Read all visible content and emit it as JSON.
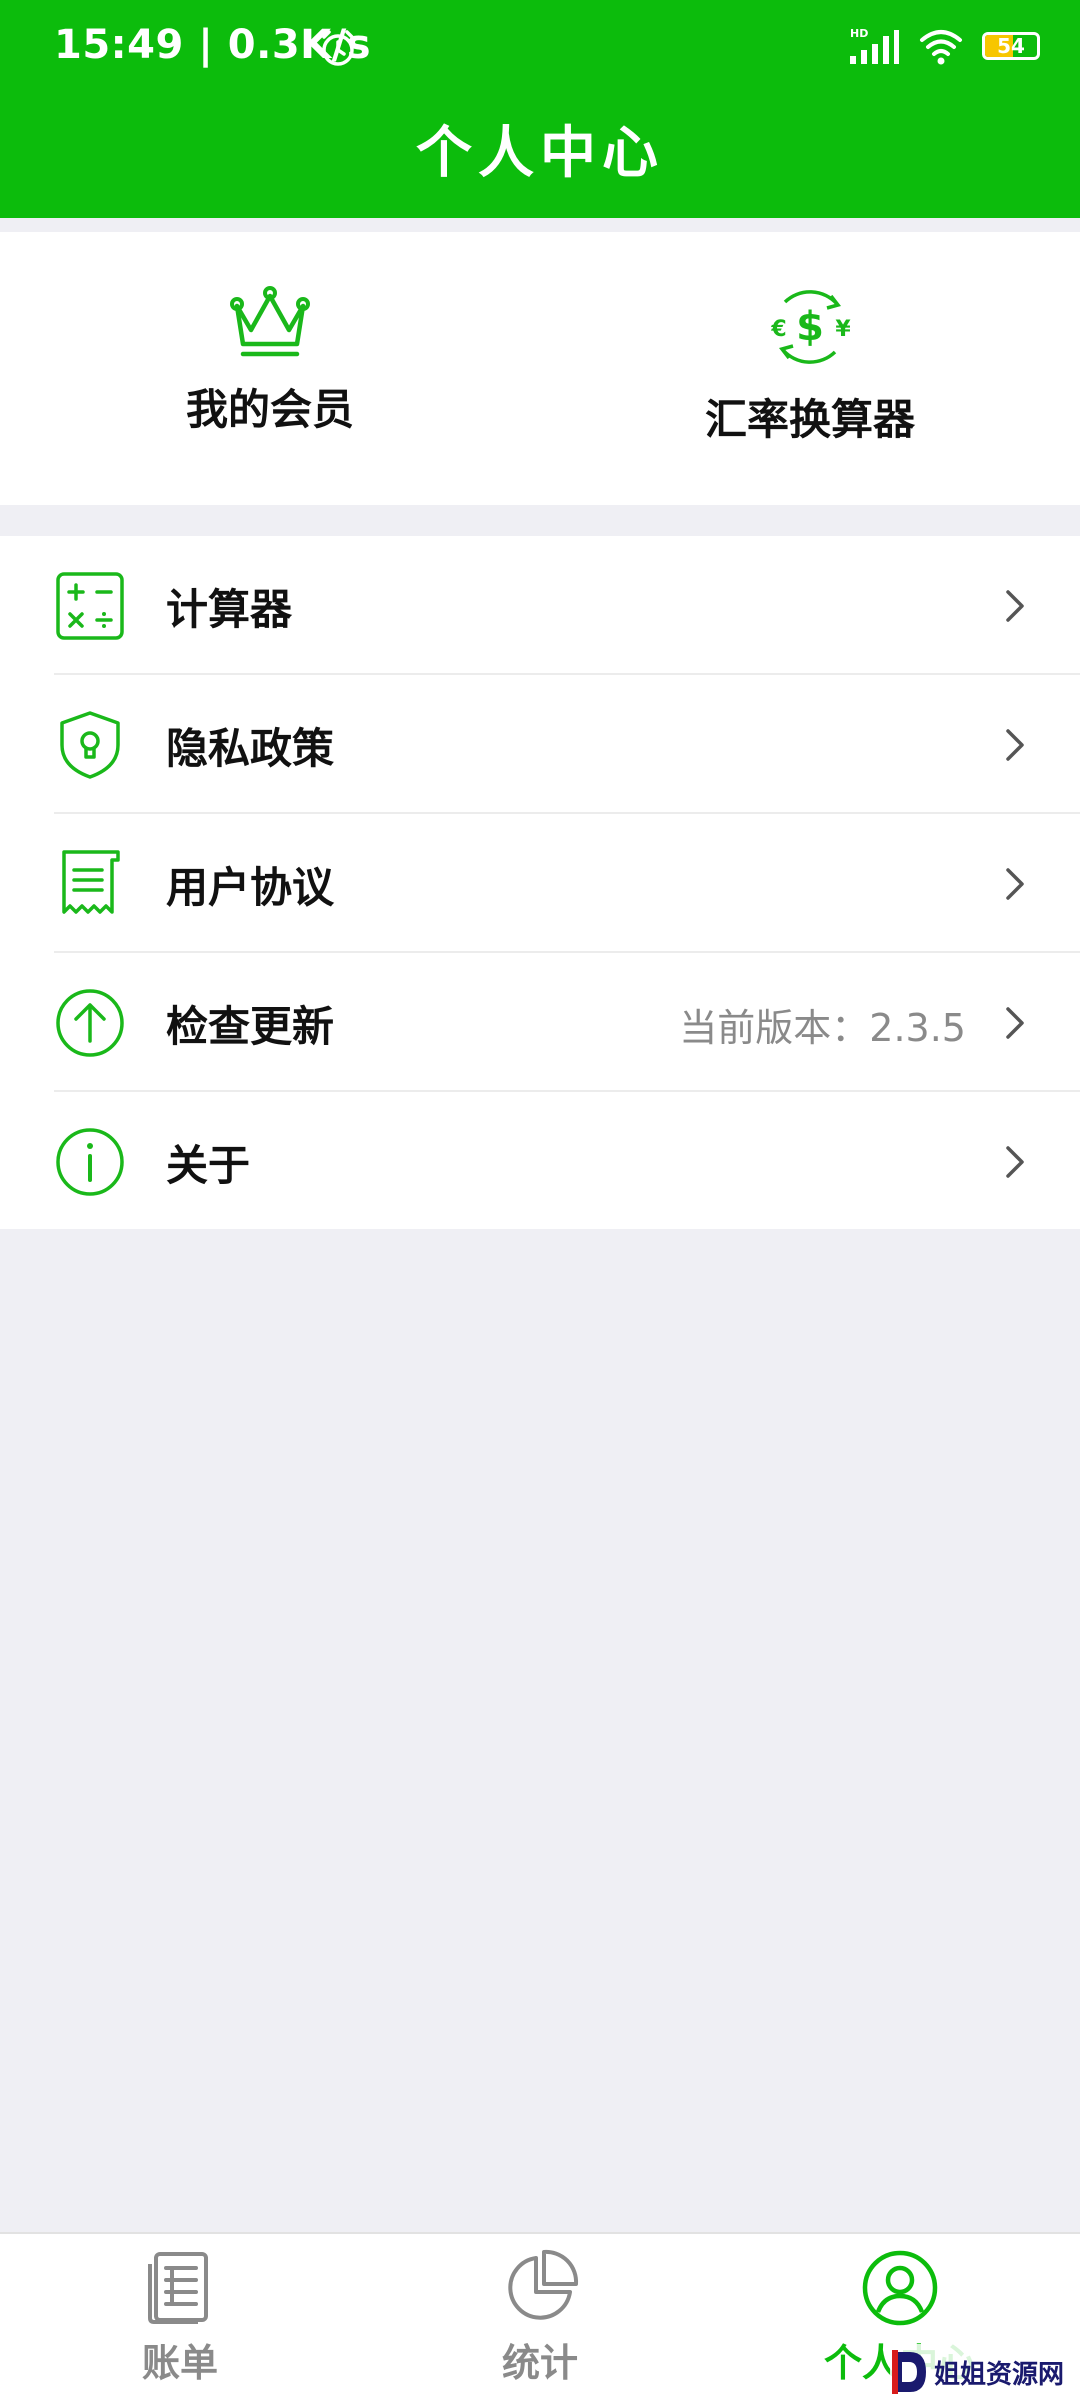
{
  "status_bar": {
    "time_text": "15:49 | 0.3K/s",
    "alarm_icon": "alarm-clock-icon",
    "signal_label": "HD",
    "battery_level": "54",
    "battery_fraction": 0.54
  },
  "header": {
    "title": "个人中心",
    "background_color": "#0cbc0c"
  },
  "quick_actions": [
    {
      "icon": "crown-icon",
      "label": "我的会员"
    },
    {
      "icon": "currency-exchange-icon",
      "label": "汇率换算器"
    }
  ],
  "menu": {
    "items": [
      {
        "icon": "calculator-icon",
        "label": "计算器",
        "extra": ""
      },
      {
        "icon": "shield-icon",
        "label": "隐私政策",
        "extra": ""
      },
      {
        "icon": "document-icon",
        "label": "用户协议",
        "extra": ""
      },
      {
        "icon": "upload-arrow-icon",
        "label": "检查更新",
        "extra": "当前版本：2.3.5"
      },
      {
        "icon": "info-icon",
        "label": "关于",
        "extra": ""
      }
    ]
  },
  "tab_bar": {
    "active_color": "#0cbc0c",
    "inactive_color": "#8a8a8a",
    "tabs": [
      {
        "icon": "ledger-icon",
        "label": "账单",
        "active": false
      },
      {
        "icon": "pie-chart-icon",
        "label": "统计",
        "active": false
      },
      {
        "icon": "user-icon",
        "label": "个人中心",
        "active": true
      }
    ]
  },
  "watermark": {
    "text": "姐姐资源网"
  }
}
